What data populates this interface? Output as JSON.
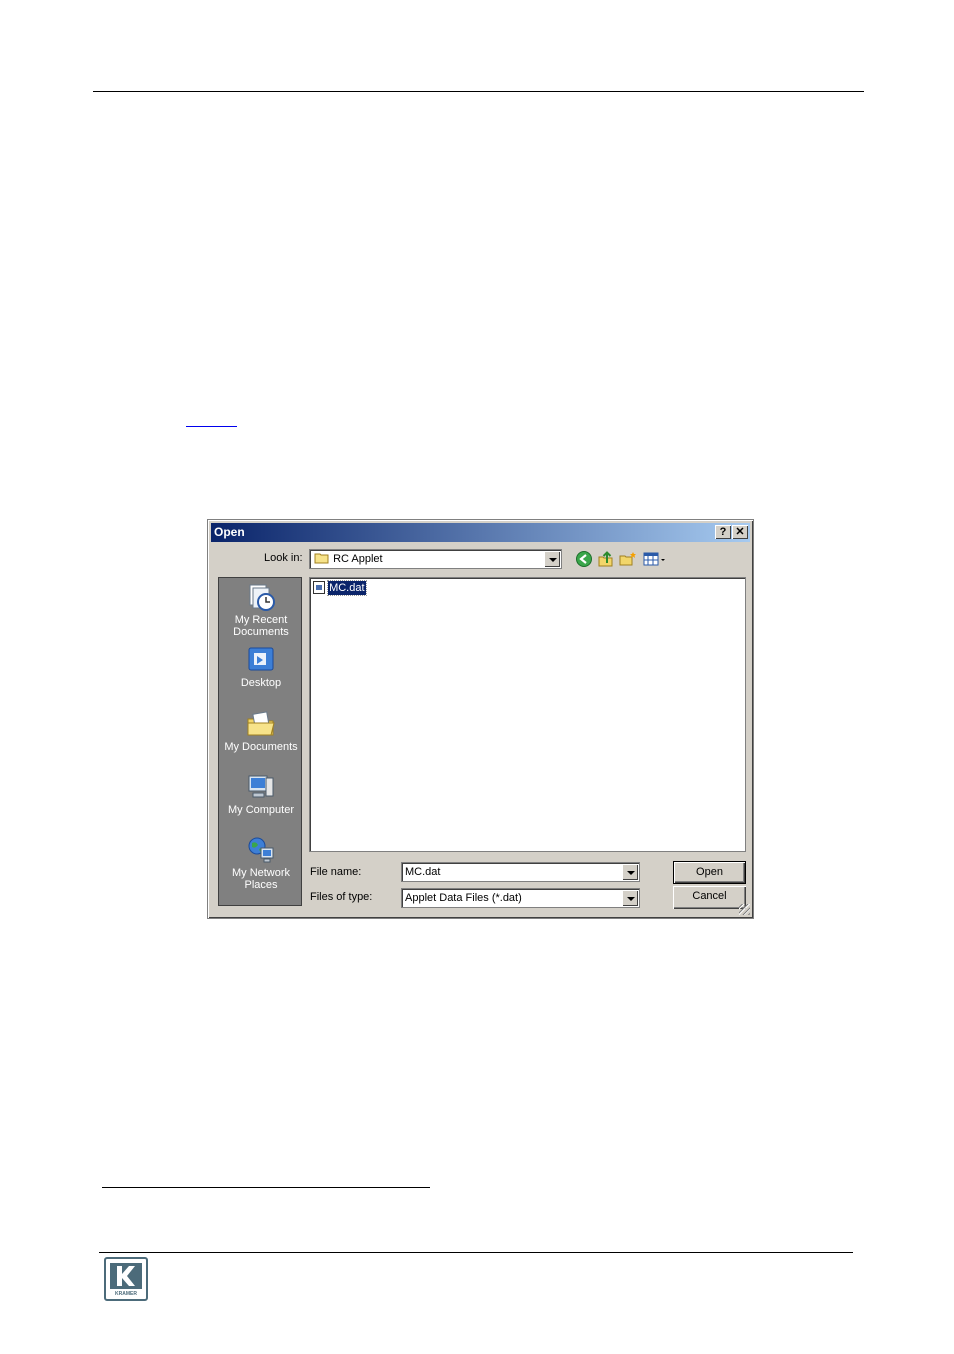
{
  "dialog": {
    "title": "Open",
    "help_button": "?",
    "close_button": "X",
    "look_in_label": "Look in:",
    "look_in_value": "RC Applet",
    "places": [
      {
        "label": "My Recent\nDocuments",
        "icon": "recent-documents-icon"
      },
      {
        "label": "Desktop",
        "icon": "desktop-icon"
      },
      {
        "label": "My Documents",
        "icon": "my-documents-icon"
      },
      {
        "label": "My Computer",
        "icon": "my-computer-icon"
      },
      {
        "label": "My Network\nPlaces",
        "icon": "network-places-icon"
      }
    ],
    "files": [
      {
        "name": "MC.dat",
        "selected": true
      }
    ],
    "file_name_label": "File name:",
    "file_name_value": "MC.dat",
    "file_type_label": "Files of type:",
    "file_type_value": "Applet Data Files (*.dat)",
    "open_button": "Open",
    "cancel_button": "Cancel"
  },
  "footer": {
    "logo_text": "KRAMER"
  },
  "colors": {
    "titlebar_start": "#0a246a",
    "titlebar_end": "#a6caf0",
    "dialog_face": "#d4d0c8",
    "places_bar": "#808080",
    "logo": "#4c6b7a"
  }
}
